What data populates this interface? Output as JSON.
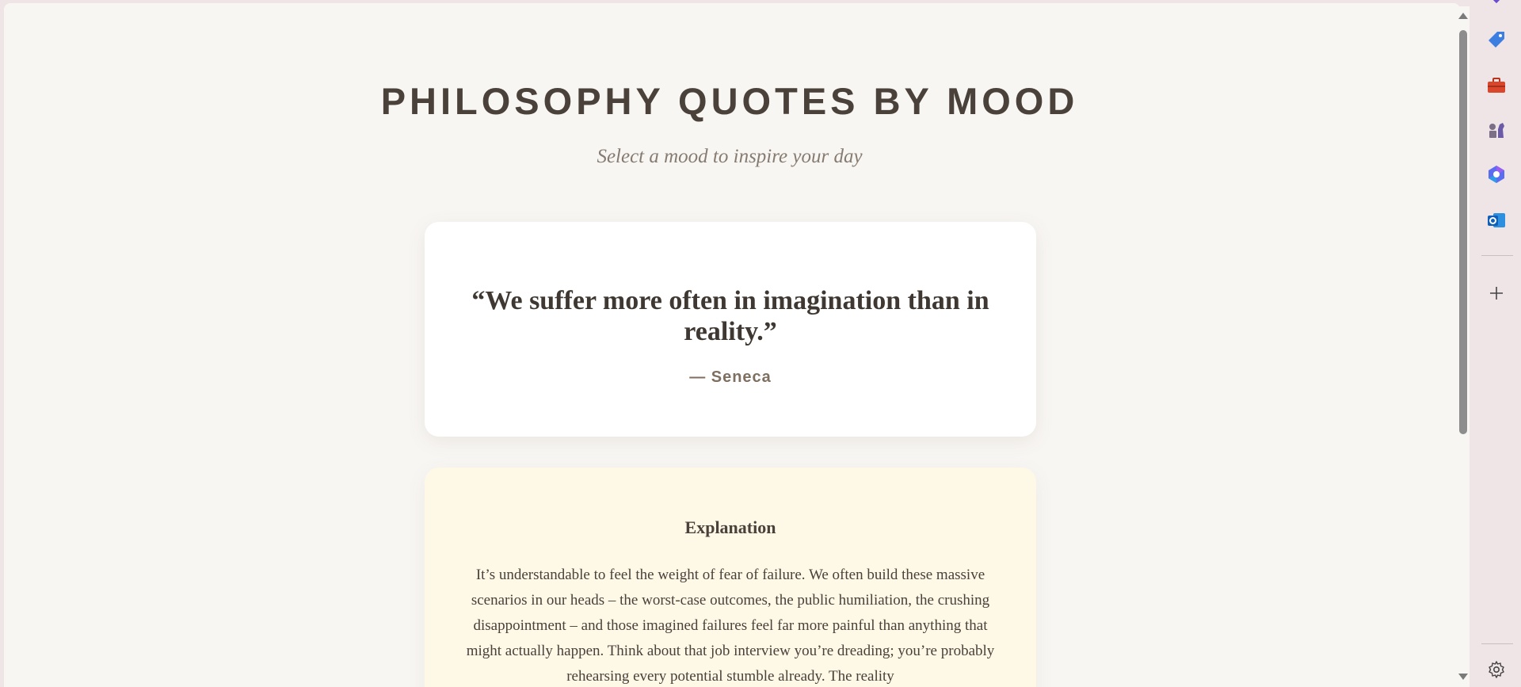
{
  "page": {
    "title": "PHILOSOPHY QUOTES BY MOOD",
    "subtitle": "Select a mood to inspire your day"
  },
  "quote": {
    "text": "“We suffer more often in imagination than in reality.”",
    "author": "— Seneca"
  },
  "explanation": {
    "heading": "Explanation",
    "body": "It’s understandable to feel the weight of fear of failure. We often build these massive scenarios in our heads – the worst-case outcomes, the public humiliation, the crushing disappointment – and those imagined failures feel far more painful than anything that might actually happen. Think about that job interview you’re dreading; you’re probably rehearsing every potential stumble already. The reality"
  },
  "sidebar": {
    "icons": [
      "tag-icon",
      "toolbox-icon",
      "chess-icon",
      "copilot-icon",
      "outlook-icon",
      "add-icon",
      "settings-icon"
    ]
  },
  "colors": {
    "background": "#f8f6f3",
    "quote_card": "#ffffff",
    "explanation_card": "#fef8e7",
    "text_dark": "#4a413a",
    "text_muted": "#867b70"
  }
}
